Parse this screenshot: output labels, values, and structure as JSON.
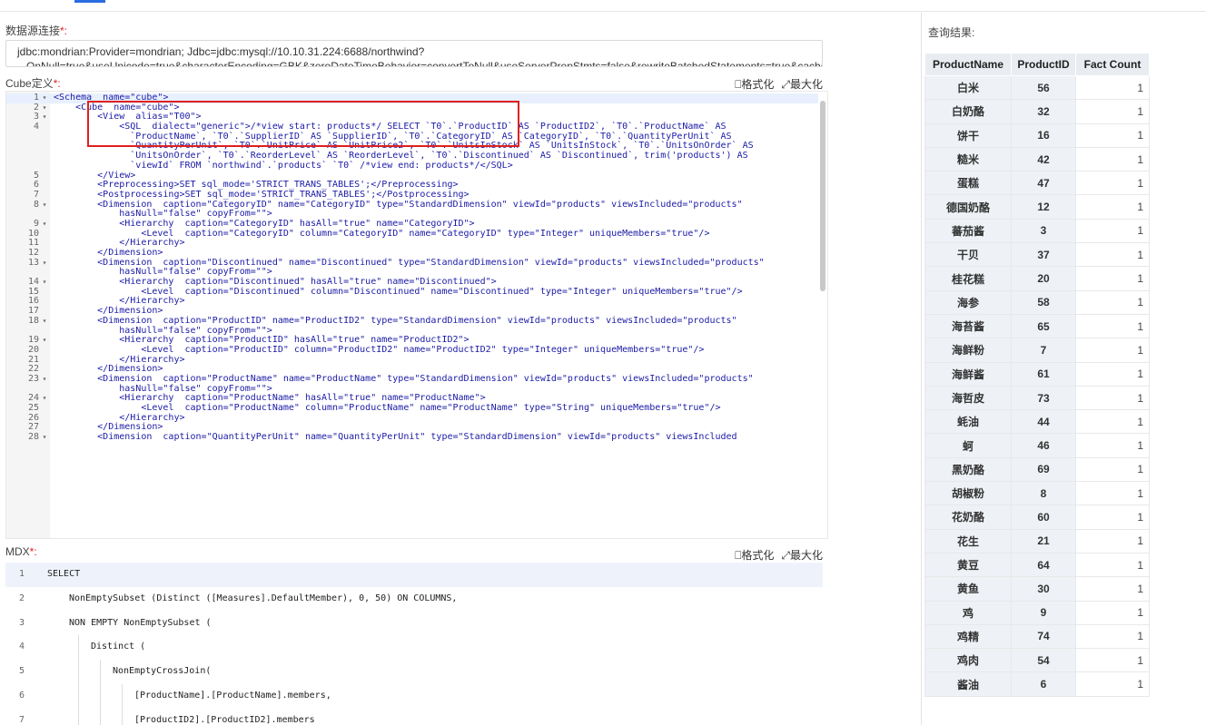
{
  "connection": {
    "label": "数据源连接",
    "required_mark": "*:",
    "line1": "jdbc:mondrian:Provider=mondrian; Jdbc=jdbc:mysql://10.10.31.224:6688/northwind?",
    "line2": "...OnNull=true&useUnicode=true&characterEncoding=GBK&zeroDateTimeBehavior=convertToNull&useServerPrepStmts=false&rewriteBatchedStatements=true&cachePrepStmts=true"
  },
  "cube": {
    "label": "Cube定义",
    "required_mark": "*:",
    "format_label": "格式化",
    "maximize_label": "最大化",
    "lines": [
      {
        "n": "1",
        "f": "▾",
        "t": "<Schema  name=\"cube\">"
      },
      {
        "n": "2",
        "f": "▾",
        "t": "    <Cube  name=\"cube\">"
      },
      {
        "n": "3",
        "f": "▾",
        "t": "        <View  alias=\"T00\">"
      },
      {
        "n": "4",
        "f": "",
        "t": "            <SQL  dialect=\"generic\">/*view start: products*/ SELECT `T0`.`ProductID` AS `ProductID2`, `T0`.`ProductName` AS"
      },
      {
        "n": "",
        "f": "",
        "t": "              `ProductName`, `T0`.`SupplierID` AS `SupplierID`, `T0`.`CategoryID` AS `CategoryID`, `T0`.`QuantityPerUnit` AS"
      },
      {
        "n": "",
        "f": "",
        "t": "              `QuantityPerUnit`, `T0`.`UnitPrice` AS `UnitPrice2`, `T0`.`UnitsInStock` AS `UnitsInStock`, `T0`.`UnitsOnOrder` AS"
      },
      {
        "n": "",
        "f": "",
        "t": "              `UnitsOnOrder`, `T0`.`ReorderLevel` AS `ReorderLevel`, `T0`.`Discontinued` AS `Discontinued`, trim('products') AS"
      },
      {
        "n": "",
        "f": "",
        "t": "              `viewId` FROM `northwind`.`products` `T0` /*view end: products*/</SQL>"
      },
      {
        "n": "5",
        "f": "",
        "t": "        </View>"
      },
      {
        "n": "6",
        "f": "",
        "t": "        <Preprocessing>SET sql_mode='STRICT_TRANS_TABLES';</Preprocessing>"
      },
      {
        "n": "7",
        "f": "",
        "t": "        <Postprocessing>SET sql_mode='STRICT_TRANS_TABLES';</Postprocessing>"
      },
      {
        "n": "8",
        "f": "▾",
        "t": "        <Dimension  caption=\"CategoryID\" name=\"CategoryID\" type=\"StandardDimension\" viewId=\"products\" viewsIncluded=\"products\""
      },
      {
        "n": "",
        "f": "",
        "t": "            hasNull=\"false\" copyFrom=\"\">"
      },
      {
        "n": "9",
        "f": "▾",
        "t": "            <Hierarchy  caption=\"CategoryID\" hasAll=\"true\" name=\"CategoryID\">"
      },
      {
        "n": "10",
        "f": "",
        "t": "                <Level  caption=\"CategoryID\" column=\"CategoryID\" name=\"CategoryID\" type=\"Integer\" uniqueMembers=\"true\"/>"
      },
      {
        "n": "11",
        "f": "",
        "t": "            </Hierarchy>"
      },
      {
        "n": "12",
        "f": "",
        "t": "        </Dimension>"
      },
      {
        "n": "13",
        "f": "▾",
        "t": "        <Dimension  caption=\"Discontinued\" name=\"Discontinued\" type=\"StandardDimension\" viewId=\"products\" viewsIncluded=\"products\""
      },
      {
        "n": "",
        "f": "",
        "t": "            hasNull=\"false\" copyFrom=\"\">"
      },
      {
        "n": "14",
        "f": "▾",
        "t": "            <Hierarchy  caption=\"Discontinued\" hasAll=\"true\" name=\"Discontinued\">"
      },
      {
        "n": "15",
        "f": "",
        "t": "                <Level  caption=\"Discontinued\" column=\"Discontinued\" name=\"Discontinued\" type=\"Integer\" uniqueMembers=\"true\"/>"
      },
      {
        "n": "16",
        "f": "",
        "t": "            </Hierarchy>"
      },
      {
        "n": "17",
        "f": "",
        "t": "        </Dimension>"
      },
      {
        "n": "18",
        "f": "▾",
        "t": "        <Dimension  caption=\"ProductID\" name=\"ProductID2\" type=\"StandardDimension\" viewId=\"products\" viewsIncluded=\"products\""
      },
      {
        "n": "",
        "f": "",
        "t": "            hasNull=\"false\" copyFrom=\"\">"
      },
      {
        "n": "19",
        "f": "▾",
        "t": "            <Hierarchy  caption=\"ProductID\" hasAll=\"true\" name=\"ProductID2\">"
      },
      {
        "n": "20",
        "f": "",
        "t": "                <Level  caption=\"ProductID\" column=\"ProductID2\" name=\"ProductID2\" type=\"Integer\" uniqueMembers=\"true\"/>"
      },
      {
        "n": "21",
        "f": "",
        "t": "            </Hierarchy>"
      },
      {
        "n": "22",
        "f": "",
        "t": "        </Dimension>"
      },
      {
        "n": "23",
        "f": "▾",
        "t": "        <Dimension  caption=\"ProductName\" name=\"ProductName\" type=\"StandardDimension\" viewId=\"products\" viewsIncluded=\"products\""
      },
      {
        "n": "",
        "f": "",
        "t": "            hasNull=\"false\" copyFrom=\"\">"
      },
      {
        "n": "24",
        "f": "▾",
        "t": "            <Hierarchy  caption=\"ProductName\" hasAll=\"true\" name=\"ProductName\">"
      },
      {
        "n": "25",
        "f": "",
        "t": "                <Level  caption=\"ProductName\" column=\"ProductName\" name=\"ProductName\" type=\"String\" uniqueMembers=\"true\"/>"
      },
      {
        "n": "26",
        "f": "",
        "t": "            </Hierarchy>"
      },
      {
        "n": "27",
        "f": "",
        "t": "        </Dimension>"
      },
      {
        "n": "28",
        "f": "▾",
        "t": "        <Dimension  caption=\"QuantityPerUnit\" name=\"QuantityPerUnit\" type=\"StandardDimension\" viewId=\"products\" viewsIncluded"
      }
    ]
  },
  "mdx": {
    "label": "MDX",
    "required_mark": "*:",
    "format_label": "格式化",
    "maximize_label": "最大化",
    "lines": [
      {
        "n": "1",
        "indent": 0,
        "t": "SELECT"
      },
      {
        "n": "2",
        "indent": 1,
        "t": "NonEmptySubset (Distinct ([Measures].DefaultMember), 0, 50) ON COLUMNS,"
      },
      {
        "n": "3",
        "indent": 1,
        "t": "NON EMPTY NonEmptySubset ("
      },
      {
        "n": "4",
        "indent": 2,
        "t": "Distinct ("
      },
      {
        "n": "5",
        "indent": 3,
        "t": "NonEmptyCrossJoin("
      },
      {
        "n": "6",
        "indent": 4,
        "t": "[ProductName].[ProductName].members,"
      },
      {
        "n": "7",
        "indent": 4,
        "t": "[ProductID2].[ProductID2].members"
      }
    ]
  },
  "results": {
    "label": "查询结果:",
    "headers": [
      "ProductName",
      "ProductID",
      "Fact Count"
    ],
    "rows": [
      [
        "白米",
        "56",
        "1"
      ],
      [
        "白奶酪",
        "32",
        "1"
      ],
      [
        "饼干",
        "16",
        "1"
      ],
      [
        "糙米",
        "42",
        "1"
      ],
      [
        "蛋糕",
        "47",
        "1"
      ],
      [
        "德国奶酪",
        "12",
        "1"
      ],
      [
        "蕃茄酱",
        "3",
        "1"
      ],
      [
        "干贝",
        "37",
        "1"
      ],
      [
        "桂花糕",
        "20",
        "1"
      ],
      [
        "海参",
        "58",
        "1"
      ],
      [
        "海苔酱",
        "65",
        "1"
      ],
      [
        "海鲜粉",
        "7",
        "1"
      ],
      [
        "海鲜酱",
        "61",
        "1"
      ],
      [
        "海哲皮",
        "73",
        "1"
      ],
      [
        "蚝油",
        "44",
        "1"
      ],
      [
        "蚵",
        "46",
        "1"
      ],
      [
        "黑奶酪",
        "69",
        "1"
      ],
      [
        "胡椒粉",
        "8",
        "1"
      ],
      [
        "花奶酪",
        "60",
        "1"
      ],
      [
        "花生",
        "21",
        "1"
      ],
      [
        "黄豆",
        "64",
        "1"
      ],
      [
        "黄鱼",
        "30",
        "1"
      ],
      [
        "鸡",
        "9",
        "1"
      ],
      [
        "鸡精",
        "74",
        "1"
      ],
      [
        "鸡肉",
        "54",
        "1"
      ],
      [
        "酱油",
        "6",
        "1"
      ]
    ]
  }
}
